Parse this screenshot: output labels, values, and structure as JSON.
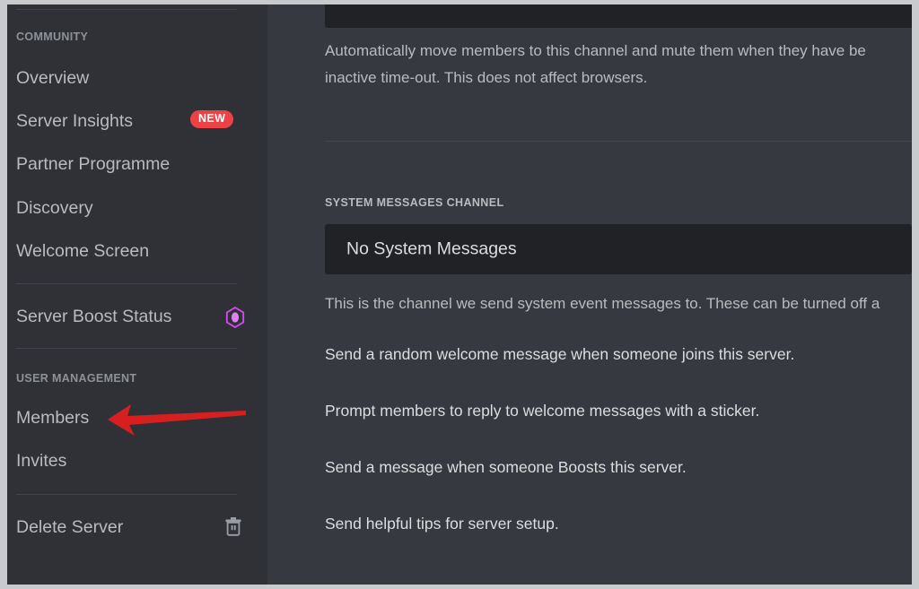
{
  "app": {
    "name": "Discord Server Settings",
    "theme": "dark"
  },
  "colors": {
    "sidebar_bg": "#2f3136",
    "main_bg": "#36393f",
    "dropdown_bg": "#202225",
    "text_primary": "#dcddde",
    "text_muted": "#b9bbbe",
    "header_muted": "#8e9297",
    "badge_red": "#ed4245",
    "boost_pink": "#ff73fa",
    "divider": "#40444b",
    "annotation_red": "#d81f1f"
  },
  "sidebar": {
    "sections": [
      {
        "header": "COMMUNITY",
        "items": [
          {
            "label": "Overview",
            "icon": null,
            "badge": null
          },
          {
            "label": "Server Insights",
            "icon": null,
            "badge": "NEW"
          },
          {
            "label": "Partner Programme",
            "icon": null,
            "badge": null
          },
          {
            "label": "Discovery",
            "icon": null,
            "badge": null
          },
          {
            "label": "Welcome Screen",
            "icon": null,
            "badge": null
          }
        ]
      },
      {
        "header": null,
        "items": [
          {
            "label": "Server Boost Status",
            "icon": "boost-gem-icon",
            "badge": null
          }
        ]
      },
      {
        "header": "USER MANAGEMENT",
        "items": [
          {
            "label": "Members",
            "icon": null,
            "badge": null
          },
          {
            "label": "Invites",
            "icon": null,
            "badge": null
          }
        ]
      },
      {
        "header": null,
        "items": [
          {
            "label": "Delete Server",
            "icon": "trash-icon",
            "badge": null
          }
        ]
      }
    ]
  },
  "main": {
    "afk_section": {
      "dropdown_primary_value": "",
      "dropdown_secondary_value": "",
      "description_line1": "Automatically move members to this channel and mute them when they have be",
      "description_line2": "inactive time-out. This does not affect browsers."
    },
    "system_messages_section": {
      "header": "SYSTEM MESSAGES CHANNEL",
      "dropdown_value": "No System Messages",
      "description": "This is the channel we send system event messages to. These can be turned off a"
    },
    "options": [
      "Send a random welcome message when someone joins this server.",
      "Prompt members to reply to welcome messages with a sticker.",
      "Send a message when someone Boosts this server.",
      "Send helpful tips for server setup."
    ]
  },
  "annotation": {
    "type": "arrow",
    "points_to": "Members",
    "color": "#d81f1f"
  }
}
